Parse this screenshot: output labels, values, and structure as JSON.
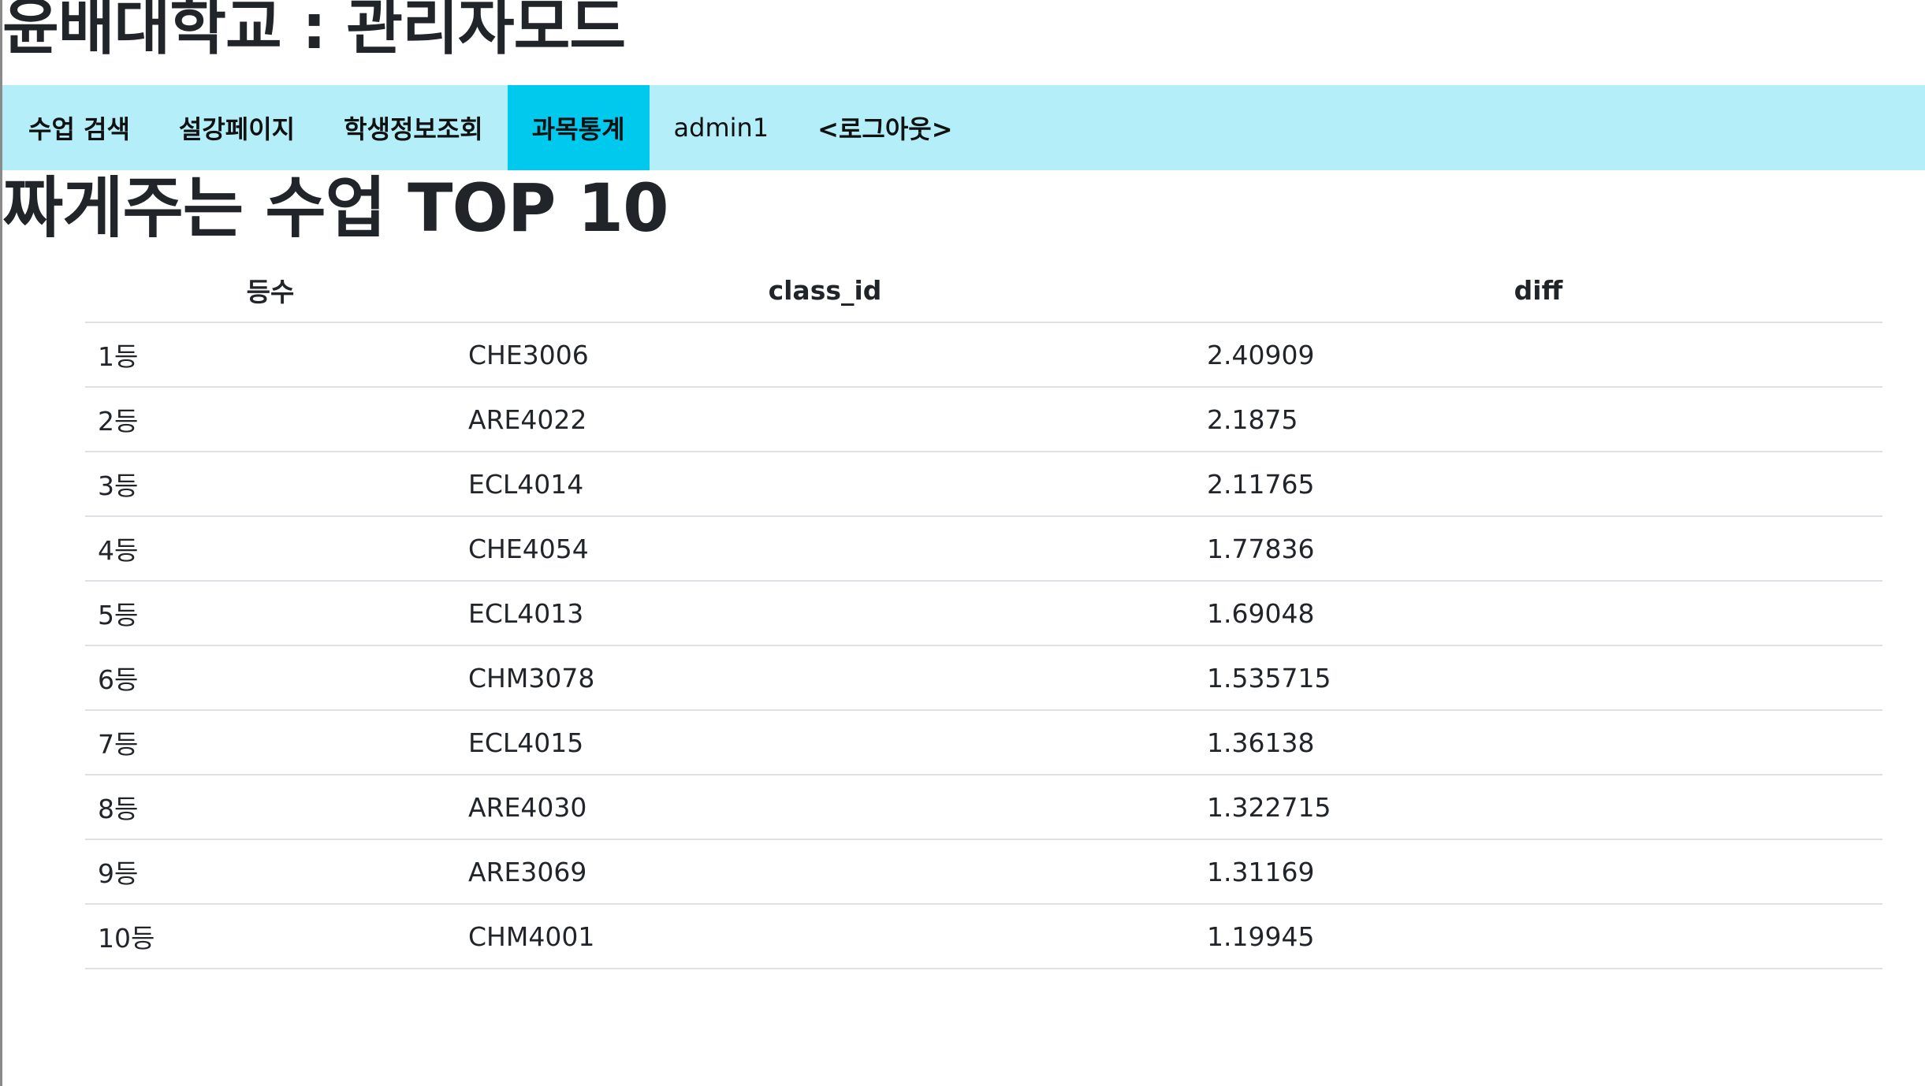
{
  "header": {
    "title": "윤배대학교 : 관리자모드"
  },
  "nav": {
    "items": [
      {
        "label": "수업 검색"
      },
      {
        "label": "설강페이지"
      },
      {
        "label": "학생정보조회"
      },
      {
        "label": "과목통계",
        "active": true
      },
      {
        "label": "admin1"
      },
      {
        "label": "<로그아웃>"
      }
    ],
    "active_color": "#00c9ee",
    "bar_color": "#b3eef9"
  },
  "section": {
    "title": "짜게주는 수업 TOP 10"
  },
  "table": {
    "headers": [
      "등수",
      "class_id",
      "diff"
    ],
    "rows": [
      [
        "1등",
        "CHE3006",
        "2.40909"
      ],
      [
        "2등",
        "ARE4022",
        "2.1875"
      ],
      [
        "3등",
        "ECL4014",
        "2.11765"
      ],
      [
        "4등",
        "CHE4054",
        "1.77836"
      ],
      [
        "5등",
        "ECL4013",
        "1.69048"
      ],
      [
        "6등",
        "CHM3078",
        "1.535715"
      ],
      [
        "7등",
        "ECL4015",
        "1.36138"
      ],
      [
        "8등",
        "ARE4030",
        "1.322715"
      ],
      [
        "9등",
        "ARE3069",
        "1.31169"
      ],
      [
        "10등",
        "CHM4001",
        "1.19945"
      ]
    ]
  }
}
